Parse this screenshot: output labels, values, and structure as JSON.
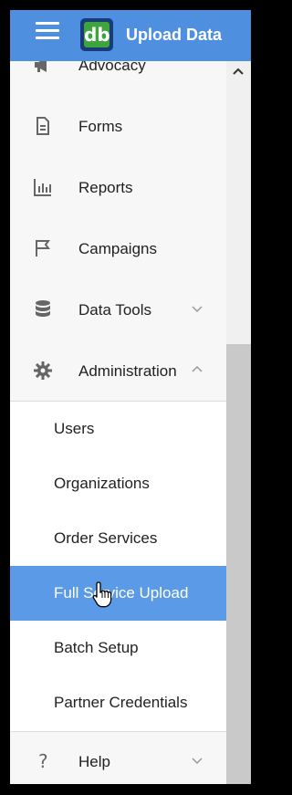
{
  "header": {
    "title": "Upload Data",
    "logo_text": "db"
  },
  "menu": {
    "items": [
      {
        "label": "Advocacy",
        "icon": "megaphone-icon"
      },
      {
        "label": "Forms",
        "icon": "document-icon"
      },
      {
        "label": "Reports",
        "icon": "bar-chart-icon"
      },
      {
        "label": "Campaigns",
        "icon": "flag-icon"
      },
      {
        "label": "Data Tools",
        "icon": "database-icon"
      },
      {
        "label": "Administration",
        "icon": "gear-icon"
      }
    ],
    "admin_sub": [
      {
        "label": "Users"
      },
      {
        "label": "Organizations"
      },
      {
        "label": "Order Services"
      },
      {
        "label": "Full Service Upload"
      },
      {
        "label": "Batch Setup"
      },
      {
        "label": "Partner Credentials"
      }
    ],
    "help": {
      "label": "Help",
      "icon": "question-icon"
    }
  },
  "colors": {
    "header": "#4f8fe0",
    "active_item": "#5b9ae6",
    "logo_green": "#3ea53e"
  }
}
